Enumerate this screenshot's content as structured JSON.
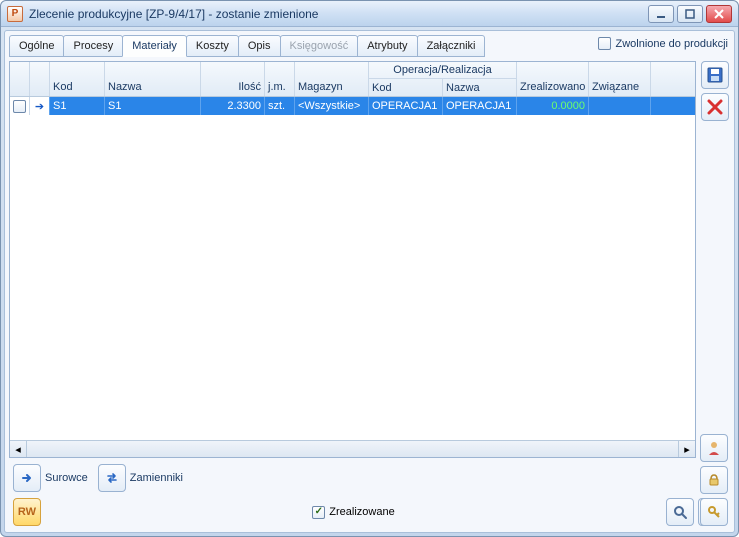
{
  "window": {
    "title": "Zlecenie produkcyjne  [ZP-9/4/17] - zostanie zmienione",
    "icon_letter": "P"
  },
  "tabs": [
    {
      "label": "Ogólne",
      "active": false,
      "disabled": false
    },
    {
      "label": "Procesy",
      "active": false,
      "disabled": false
    },
    {
      "label": "Materiały",
      "active": true,
      "disabled": false
    },
    {
      "label": "Koszty",
      "active": false,
      "disabled": false
    },
    {
      "label": "Opis",
      "active": false,
      "disabled": false
    },
    {
      "label": "Księgowość",
      "active": false,
      "disabled": true
    },
    {
      "label": "Atrybuty",
      "active": false,
      "disabled": false
    },
    {
      "label": "Załączniki",
      "active": false,
      "disabled": false
    }
  ],
  "header_check": {
    "label": "Zwolnione do produkcji",
    "checked": false
  },
  "grid": {
    "columns": {
      "kod": "Kod",
      "nazwa": "Nazwa",
      "ilosc": "Ilość",
      "jm": "j.m.",
      "magazyn": "Magazyn",
      "operacja_group": "Operacja/Realizacja",
      "op_kod": "Kod",
      "op_nazwa": "Nazwa",
      "zrealizowano": "Zrealizowano",
      "zwiazane": "Związane"
    },
    "rows": [
      {
        "checked": false,
        "kod": "S1",
        "nazwa": "S1",
        "ilosc": "2.3300",
        "jm": "szt.",
        "magazyn": "<Wszystkie>",
        "op_kod": "OPERACJA1",
        "op_nazwa": "OPERACJA1",
        "zrealizowano": "0.0000",
        "zwiazane": ""
      }
    ]
  },
  "bottom1": {
    "surowce_label": "Surowce",
    "zamienniki_label": "Zamienniki"
  },
  "bottom2": {
    "rw_label": "RW",
    "zrealizowane_label": "Zrealizowane",
    "zrealizowane_checked": true
  }
}
